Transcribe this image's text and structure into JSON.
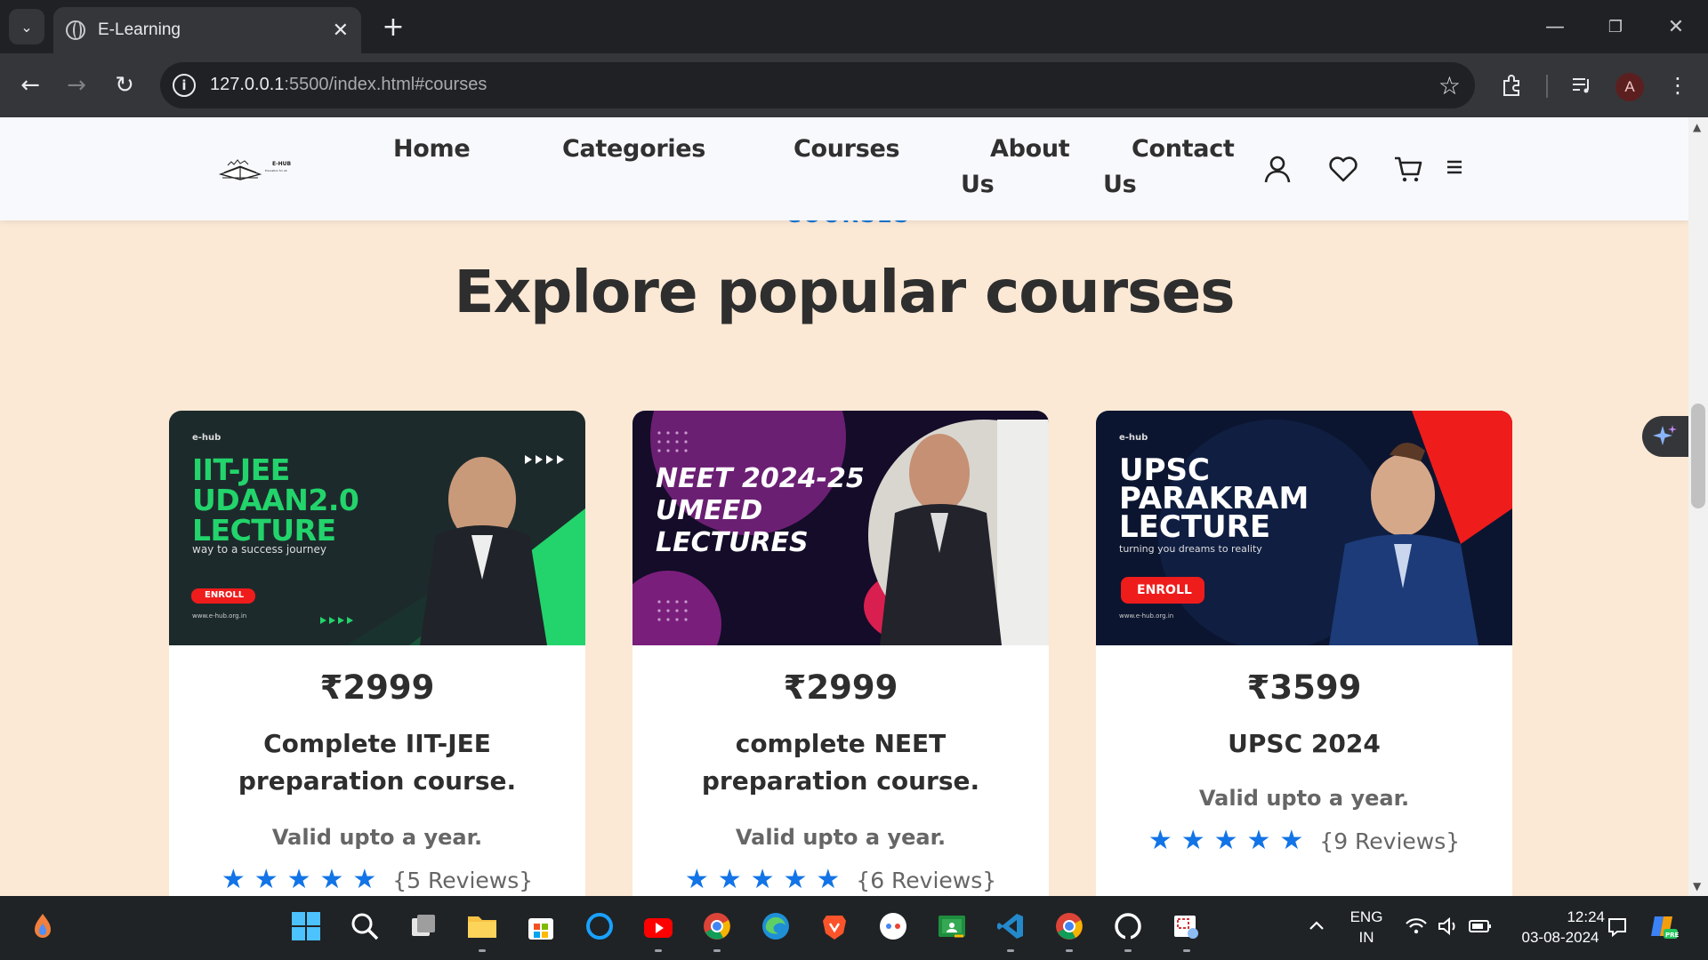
{
  "browser": {
    "tab_title": "E-Learning",
    "url_host": "127.0.0.1",
    "url_rest": ":5500/index.html#courses",
    "profile_initial": "A"
  },
  "site": {
    "logo_text": "E-HUB",
    "logo_sub": "Education for all",
    "nav": [
      "Home",
      "Categories",
      "Courses",
      "About",
      "Us",
      "Contact",
      "Us"
    ],
    "eyebrow": "COURSES",
    "section_title": "Explore popular courses"
  },
  "courses": [
    {
      "price": "₹2999",
      "name": "Complete IIT-JEE preparation course.",
      "validity": "Valid upto a year.",
      "rating": 5,
      "reviews": "{5 Reviews}",
      "banner": {
        "brand": "e-hub",
        "lines": [
          "IIT-JEE",
          "UDAAN2.0",
          "LECTURE"
        ],
        "tagline": "way to a success journey",
        "cta": "ENROLL",
        "site": "www.e-hub.org.in",
        "accent": "#22d46b"
      }
    },
    {
      "price": "₹2999",
      "name": "complete NEET preparation course.",
      "validity": "Valid upto a year.",
      "rating": 5,
      "reviews": "{6 Reviews}",
      "banner": {
        "lines": [
          "NEET 2024-25",
          "UMEED",
          "LECTURES"
        ],
        "accent": "#c2185b"
      }
    },
    {
      "price": "₹3599",
      "name": "UPSC 2024",
      "validity": "Valid upto a year.",
      "rating": 5,
      "reviews": "{9 Reviews}",
      "banner": {
        "brand": "e-hub",
        "lines": [
          "UPSC",
          "PARAKRAM",
          "LECTURE"
        ],
        "tagline": "turning you dreams to reality",
        "cta": "ENROLL",
        "site": "www.e-hub.org.in",
        "accent": "#ef1c1c"
      }
    }
  ],
  "taskbar": {
    "lang_line1": "ENG",
    "lang_line2": "IN",
    "time": "12:24",
    "date": "03-08-2024"
  },
  "colors": {
    "page_bg": "#fbe9d5",
    "accent_blue": "#1976d2",
    "star_blue": "#1274e6"
  }
}
